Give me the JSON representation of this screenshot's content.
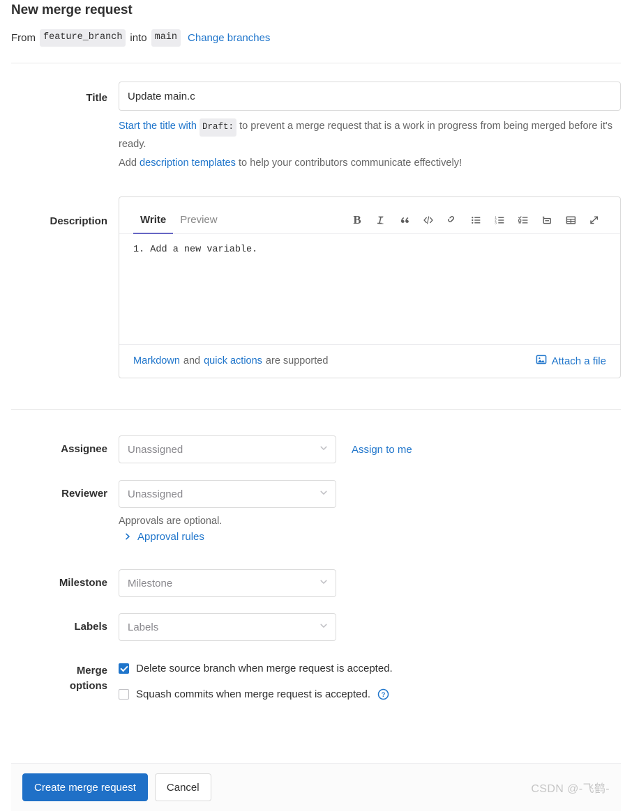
{
  "header": {
    "title": "New merge request",
    "from_word": "From",
    "source_branch": "feature_branch",
    "into_word": "into",
    "target_branch": "main",
    "change_branches_link": "Change branches"
  },
  "title_field": {
    "label": "Title",
    "value": "Update main.c",
    "hint_link": "Start the title with",
    "hint_code": "Draft:",
    "hint_rest": "to prevent a merge request that is a work in progress from being merged before it's ready.",
    "templates_prefix": "Add",
    "templates_link": "description templates",
    "templates_suffix": "to help your contributors communicate effectively!"
  },
  "description": {
    "label": "Description",
    "tabs": [
      {
        "label": "Write",
        "active": true
      },
      {
        "label": "Preview",
        "active": false
      }
    ],
    "toolbar": [
      {
        "name": "bold-icon",
        "title": "Bold"
      },
      {
        "name": "italic-icon",
        "title": "Italic"
      },
      {
        "name": "quote-icon",
        "title": "Insert a quote"
      },
      {
        "name": "code-icon",
        "title": "Insert code"
      },
      {
        "name": "link-icon",
        "title": "Add a link"
      },
      {
        "name": "bullet-list-icon",
        "title": "Add a bullet list"
      },
      {
        "name": "numbered-list-icon",
        "title": "Add a numbered list"
      },
      {
        "name": "task-list-icon",
        "title": "Add a checklist"
      },
      {
        "name": "collapsible-section-icon",
        "title": "Add a collapsible section"
      },
      {
        "name": "table-icon",
        "title": "Add a table"
      },
      {
        "name": "fullscreen-icon",
        "title": "Go full screen"
      }
    ],
    "body_text": "1. Add a new variable.",
    "footer": {
      "markdown_link": "Markdown",
      "and_word": "and",
      "quick_actions_link": "quick actions",
      "supported_text": "are supported",
      "attach_label": "Attach a file",
      "attach_icon": "image-icon"
    }
  },
  "assignee": {
    "label": "Assignee",
    "value": "Unassigned",
    "assign_to_me_link": "Assign to me"
  },
  "reviewer": {
    "label": "Reviewer",
    "value": "Unassigned",
    "approvals_note": "Approvals are optional.",
    "approval_rules_link": "Approval rules"
  },
  "milestone": {
    "label": "Milestone",
    "value": "Milestone"
  },
  "labels": {
    "label": "Labels",
    "value": "Labels"
  },
  "merge_options": {
    "label_line1": "Merge",
    "label_line2": "options",
    "items": [
      {
        "label": "Delete source branch when merge request is accepted.",
        "checked": true,
        "help": false
      },
      {
        "label": "Squash commits when merge request is accepted.",
        "checked": false,
        "help": true
      }
    ]
  },
  "footer": {
    "submit_label": "Create merge request",
    "cancel_label": "Cancel",
    "watermark": "CSDN @-飞鹤-"
  },
  "colors": {
    "link": "#1f75cb",
    "primary_button": "#1f70c7",
    "checkbox_checked": "#1f75cb",
    "tab_active_underline": "#6666c4",
    "border": "#dbdbdb",
    "footer_bg": "#fbfbfb"
  }
}
